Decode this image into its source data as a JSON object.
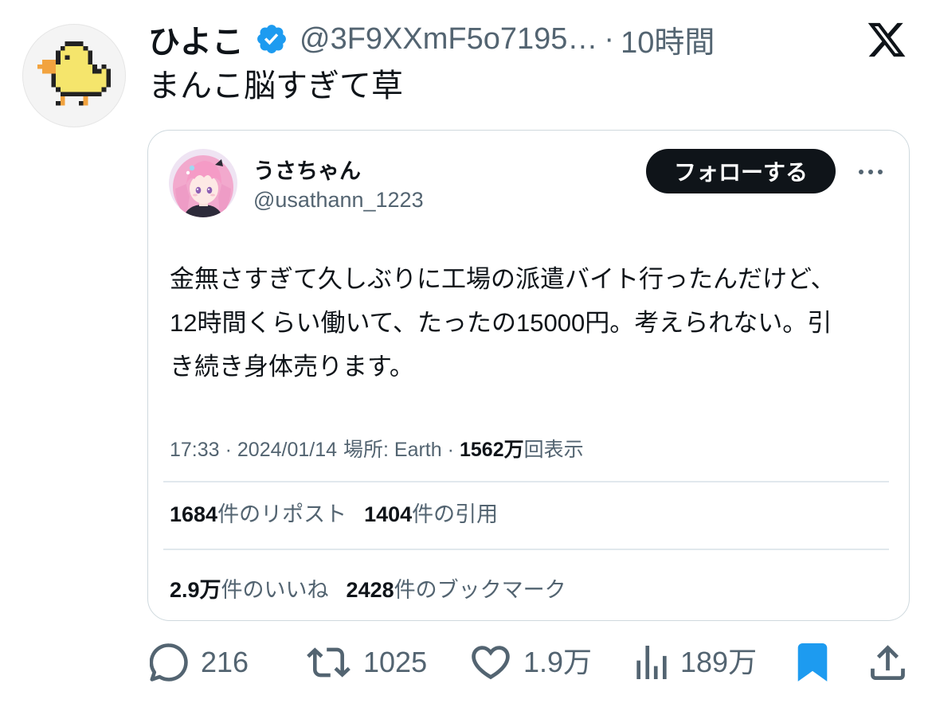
{
  "post": {
    "author": {
      "name": "ひよこ",
      "handle": "@3F9XXmF5o7195…",
      "verified": true
    },
    "separator": "·",
    "time": "10時間",
    "text": "まんこ脳すぎて草"
  },
  "quoted_post": {
    "author": {
      "name": "うさちゃん",
      "handle": "@usathann_1223"
    },
    "follow_label": "フォローする",
    "text_lines": [
      "金無さすぎて久しぶりに工場の派遣バイト行ったんだけど、",
      "12時間くらい働いて、たったの15000円。考えられない。引",
      "き続き身体売ります。"
    ],
    "meta": {
      "time": "17:33",
      "separator": "·",
      "date": "2024/01/14",
      "location": "場所: Earth",
      "views_count": "1562万",
      "views_label": "回表示"
    },
    "stats": [
      {
        "count": "1684",
        "label": "件のリポスト"
      },
      {
        "count": "1404",
        "label": "件の引用"
      },
      {
        "count": "2.9万",
        "label": "件のいいね"
      },
      {
        "count": "2428",
        "label": "件のブックマーク"
      }
    ]
  },
  "actions": {
    "replies": "216",
    "reposts": "1025",
    "likes": "1.9万",
    "views": "189万",
    "bookmarked": true
  },
  "icons": {
    "verified": "verified-badge-icon",
    "x_logo": "x-logo-icon",
    "more": "more-icon",
    "reply": "reply-icon",
    "repost": "repost-icon",
    "like": "heart-icon",
    "views": "views-icon",
    "bookmark": "bookmark-icon",
    "share": "share-icon"
  },
  "colors": {
    "text": "#0f1419",
    "secondary": "#536471",
    "accent": "#1d9bf0",
    "border": "#cfd9de",
    "divider": "#e1e8ed",
    "follow_button": "#0f1419",
    "follow_text": "#ffffff",
    "background": "#ffffff"
  }
}
